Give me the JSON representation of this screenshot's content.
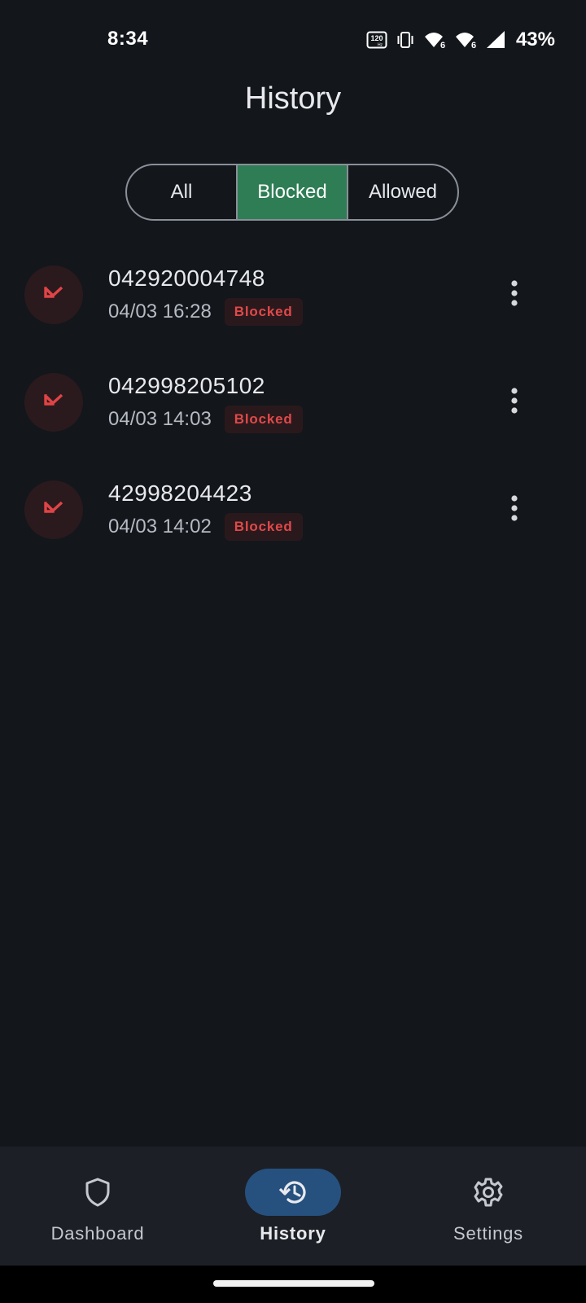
{
  "status_bar": {
    "time": "8:34",
    "battery": "43%",
    "icons": [
      "refresh-rate-120hz-icon",
      "vibrate-icon",
      "wifi-6-icon",
      "wifi-6-icon",
      "cell-signal-icon"
    ]
  },
  "page_title": "History",
  "filter_tabs": [
    {
      "label": "All",
      "selected": false
    },
    {
      "label": "Blocked",
      "selected": true
    },
    {
      "label": "Allowed",
      "selected": false
    }
  ],
  "history": [
    {
      "number": "042920004748",
      "timestamp": "04/03 16:28",
      "status": "Blocked",
      "icon": "call-blocked-icon"
    },
    {
      "number": "042998205102",
      "timestamp": "04/03 14:03",
      "status": "Blocked",
      "icon": "call-blocked-icon"
    },
    {
      "number": "42998204423",
      "timestamp": "04/03 14:02",
      "status": "Blocked",
      "icon": "call-blocked-icon"
    }
  ],
  "bottom_nav": [
    {
      "label": "Dashboard",
      "icon": "shield-icon",
      "active": false
    },
    {
      "label": "History",
      "icon": "history-icon",
      "active": true
    },
    {
      "label": "Settings",
      "icon": "gear-icon",
      "active": false
    }
  ],
  "colors": {
    "background": "#13161b",
    "accent_selected": "#2f7d55",
    "blocked_red": "#e0494a",
    "nav_active_pill": "#26507e"
  }
}
